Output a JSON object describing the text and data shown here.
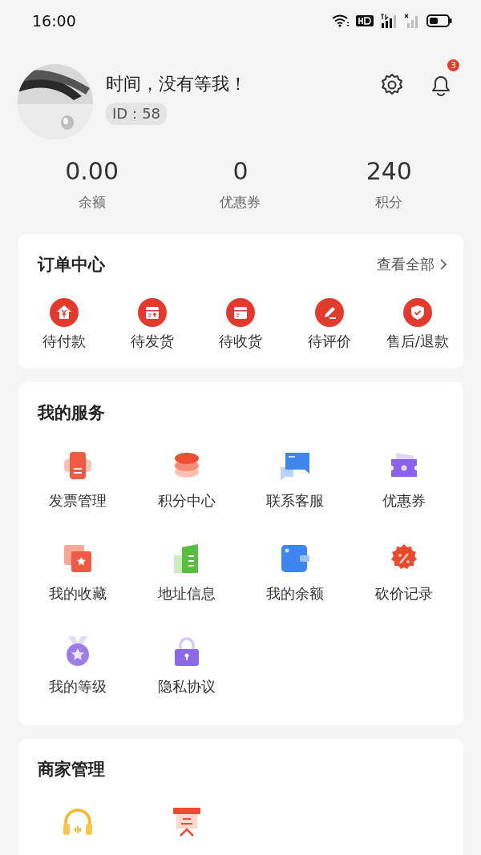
{
  "status_bar": {
    "time": "16:00"
  },
  "profile": {
    "name": "时间，没有等我！",
    "id": "ID：58",
    "notification_count": "3"
  },
  "stats": [
    {
      "value": "0.00",
      "label": "余额"
    },
    {
      "value": "0",
      "label": "优惠券"
    },
    {
      "value": "240",
      "label": "积分"
    }
  ],
  "orders": {
    "title": "订单中心",
    "more": "查看全部",
    "items": [
      "待付款",
      "待发货",
      "待收货",
      "待评价",
      "售后/退款"
    ]
  },
  "services": {
    "title": "我的服务",
    "items": [
      "发票管理",
      "积分中心",
      "联系客服",
      "优惠券",
      "我的收藏",
      "地址信息",
      "我的余额",
      "砍价记录",
      "我的等级",
      "隐私协议"
    ]
  },
  "merchant": {
    "title": "商家管理"
  }
}
